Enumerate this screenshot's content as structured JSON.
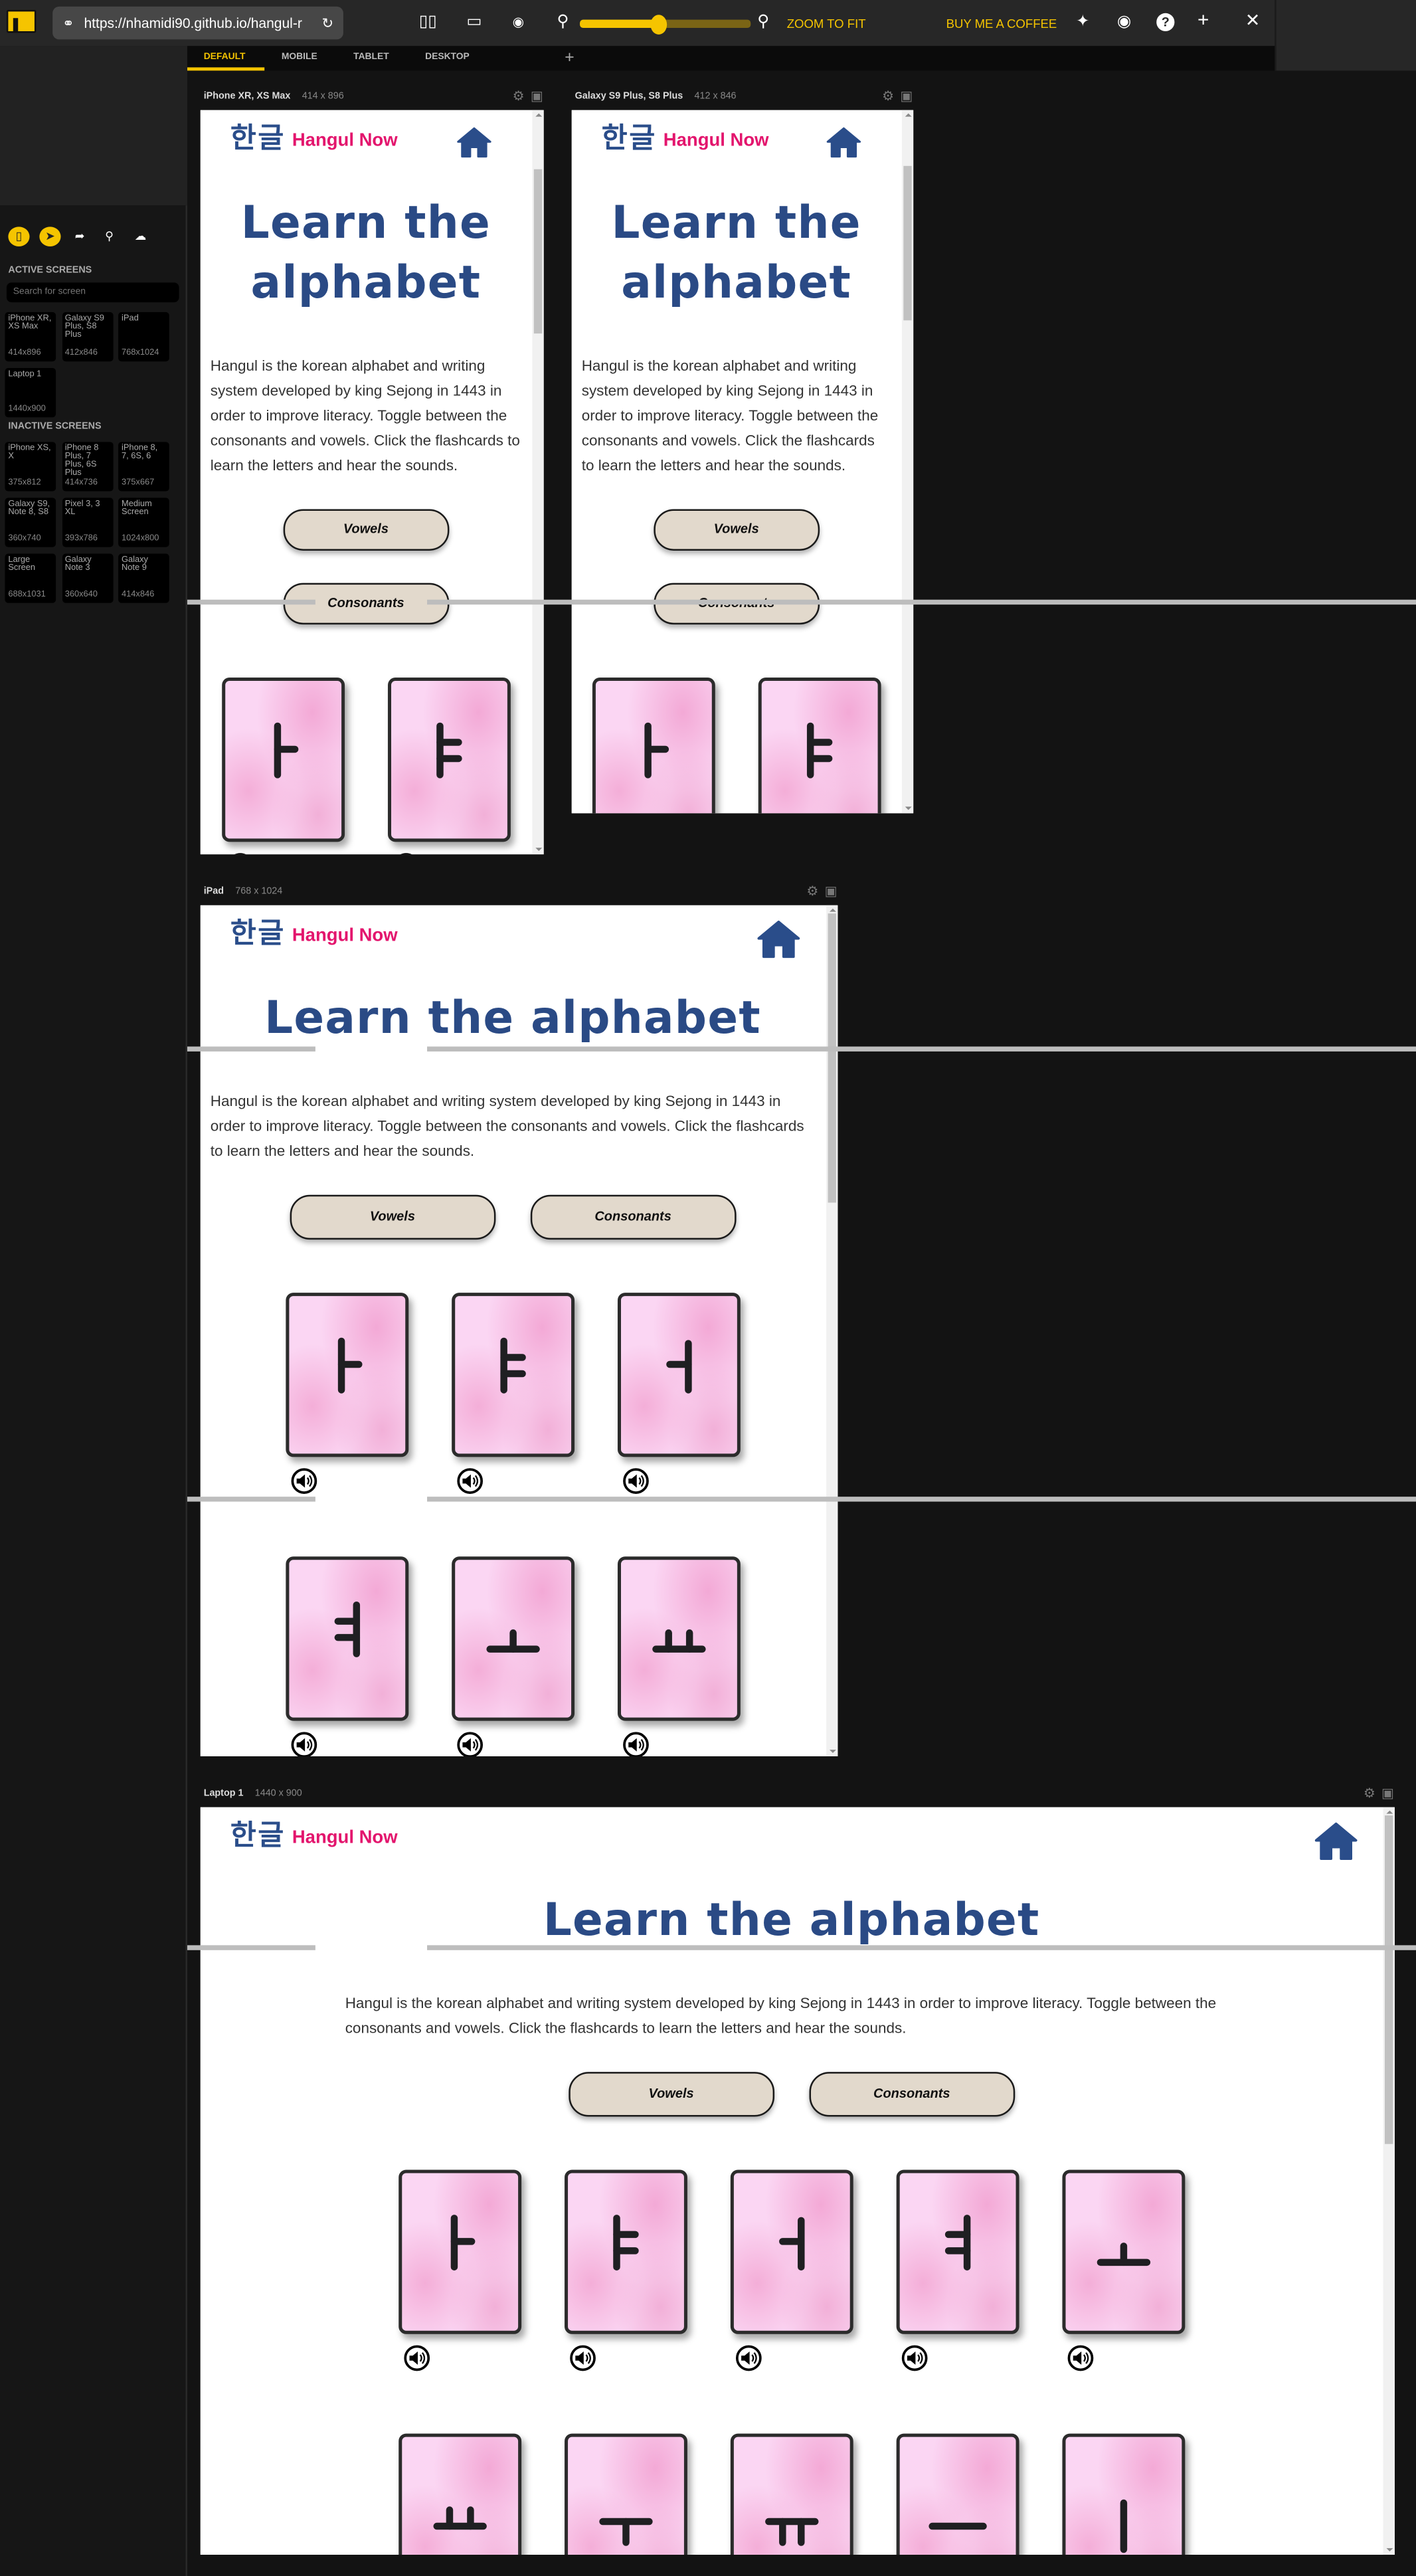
{
  "toolbar": {
    "url": "https://nhamidi90.github.io/hangul-r",
    "zoom_to_fit": "ZOOM TO FIT",
    "buy_coffee": "BUY ME A COFFEE",
    "zoom_slider_value": 0.46
  },
  "tabs": [
    {
      "label": "DEFAULT",
      "active": true
    },
    {
      "label": "MOBILE"
    },
    {
      "label": "TABLET"
    },
    {
      "label": "DESKTOP"
    }
  ],
  "sidebar": {
    "active_title": "ACTIVE SCREENS",
    "search_placeholder": "Search for screen",
    "active_screens": [
      {
        "name": "iPhone XR, XS Max",
        "size": "414x896"
      },
      {
        "name": "Galaxy S9 Plus, S8 Plus",
        "size": "412x846"
      },
      {
        "name": "iPad",
        "size": "768x1024"
      },
      {
        "name": "Laptop 1",
        "size": "1440x900"
      }
    ],
    "inactive_title": "INACTIVE SCREENS",
    "inactive_screens": [
      {
        "name": "iPhone XS, X",
        "size": "375x812"
      },
      {
        "name": "iPhone 8 Plus, 7 Plus, 6S Plus",
        "size": "414x736"
      },
      {
        "name": "iPhone 8, 7, 6S, 6",
        "size": "375x667"
      },
      {
        "name": "Galaxy S9, Note 8, S8",
        "size": "360x740"
      },
      {
        "name": "Pixel 3, 3 XL",
        "size": "393x786"
      },
      {
        "name": "Medium Screen",
        "size": "1024x800"
      },
      {
        "name": "Large Screen",
        "size": "688x1031"
      },
      {
        "name": "Galaxy Note 3",
        "size": "360x640"
      },
      {
        "name": "Galaxy Note 9",
        "size": "414x846"
      }
    ]
  },
  "frames": [
    {
      "name": "iPhone XR, XS Max",
      "size": "414 x 896"
    },
    {
      "name": "Galaxy S9 Plus, S8 Plus",
      "size": "412 x 846"
    },
    {
      "name": "iPad",
      "size": "768 x 1024"
    },
    {
      "name": "Laptop 1",
      "size": "1440 x 900"
    }
  ],
  "site": {
    "logo_hangul": "한글",
    "brand": "Hangul Now",
    "title": "Learn the alphabet",
    "description": "Hangul is the korean alphabet and writing system developed by king Sejong in 1443 in order to improve literacy. Toggle between the consonants and vowels. Click the flashcards to learn the letters and hear the sounds.",
    "vowels_button": "Vowels",
    "consonants_button": "Consonants",
    "letters": [
      "ㅏ",
      "ㅑ",
      "ㅓ",
      "ㅕ",
      "ㅗ",
      "ㅛ",
      "ㅜ",
      "ㅠ",
      "ㅡ",
      "ㅣ"
    ]
  },
  "colors": {
    "accent": "#f5c400",
    "brand_pink": "#e3156d",
    "brand_blue": "#2a4d8a",
    "button_bg": "#e2d9cc"
  }
}
